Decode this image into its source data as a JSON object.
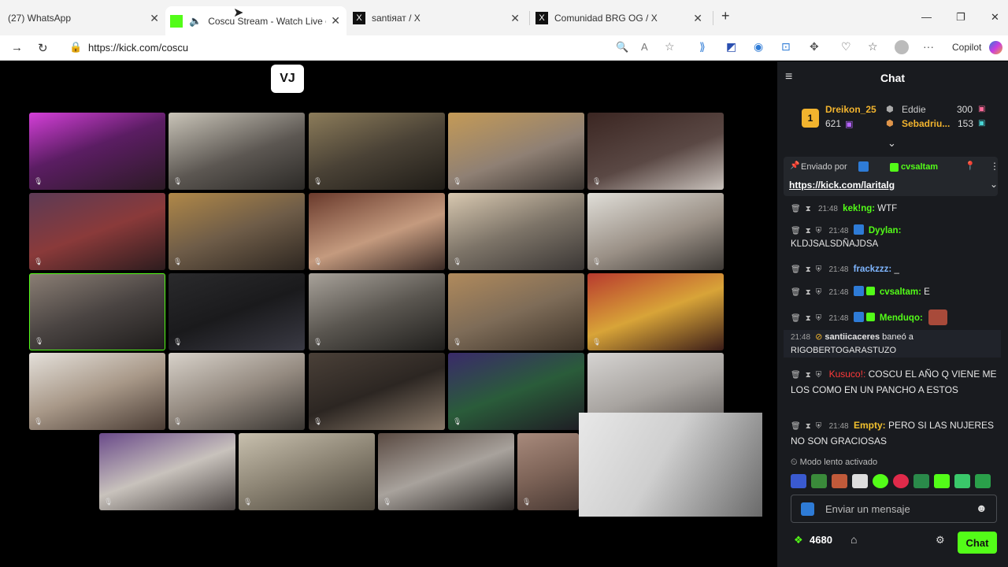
{
  "browser": {
    "tabs": [
      {
        "title": "(27) WhatsApp",
        "active": false
      },
      {
        "title": "Coscu Stream - Watch Live o",
        "active": true
      },
      {
        "title": "santiяат / X",
        "active": false
      },
      {
        "title": "Comunidad BRG OG / X",
        "active": false
      }
    ],
    "new_tab": "+",
    "url": "https://kick.com/coscu",
    "profile_label": "Copilot"
  },
  "video": {
    "logo": "VJ",
    "grid_rows": [
      {
        "count": 5
      },
      {
        "count": 5
      },
      {
        "count": 5
      },
      {
        "count": 5
      },
      {
        "count": 4
      }
    ]
  },
  "chat": {
    "title": "Chat",
    "leaderboard": [
      {
        "rank": "1",
        "name": "Dreikon_25",
        "points": "621"
      },
      {
        "name": "Eddie",
        "points": "300"
      },
      {
        "name": "Sebadriu...",
        "points": "153"
      }
    ],
    "pinned": {
      "label": "Enviado por",
      "user": "cvsaltam",
      "link": "https://kick.com/laritalg"
    },
    "messages": [
      {
        "time": "21:48",
        "user": "kek!ng:",
        "text": "WTF",
        "color": "#53fc18"
      },
      {
        "time": "21:48",
        "user": "Dyylan:",
        "text": "KLDJSALSDÑAJDSA",
        "color": "#53fc18"
      },
      {
        "time": "21:48",
        "user": "frackzzz:",
        "text": "_",
        "color": "#7fb6ff"
      },
      {
        "time": "21:48",
        "user": "cvsaltam:",
        "text": "E",
        "color": "#53fc18"
      },
      {
        "time": "21:48",
        "user": "Menduqo:",
        "text": "",
        "color": "#53fc18"
      },
      {
        "time": "21:48",
        "user": "santiicaceres",
        "text": "baneó a RIGOBERTOGARASTUZO",
        "color": "#ffffff"
      },
      {
        "time": "",
        "user": "Kusuco!:",
        "text": "COSCU EL AÑO Q VIENE ME LOS COMO EN UN PANCHO A ESTOS",
        "color": "#ff3a3a"
      },
      {
        "time": "21:48",
        "user": "Empty:",
        "text": "PERO SI LAS NUJERES NO SON GRACIOSAS",
        "color": "#f2c12e"
      }
    ],
    "slow_mode": "Modo lento activado",
    "input_placeholder": "Enviar un mensaje",
    "points": "4680",
    "send_label": "Chat"
  }
}
